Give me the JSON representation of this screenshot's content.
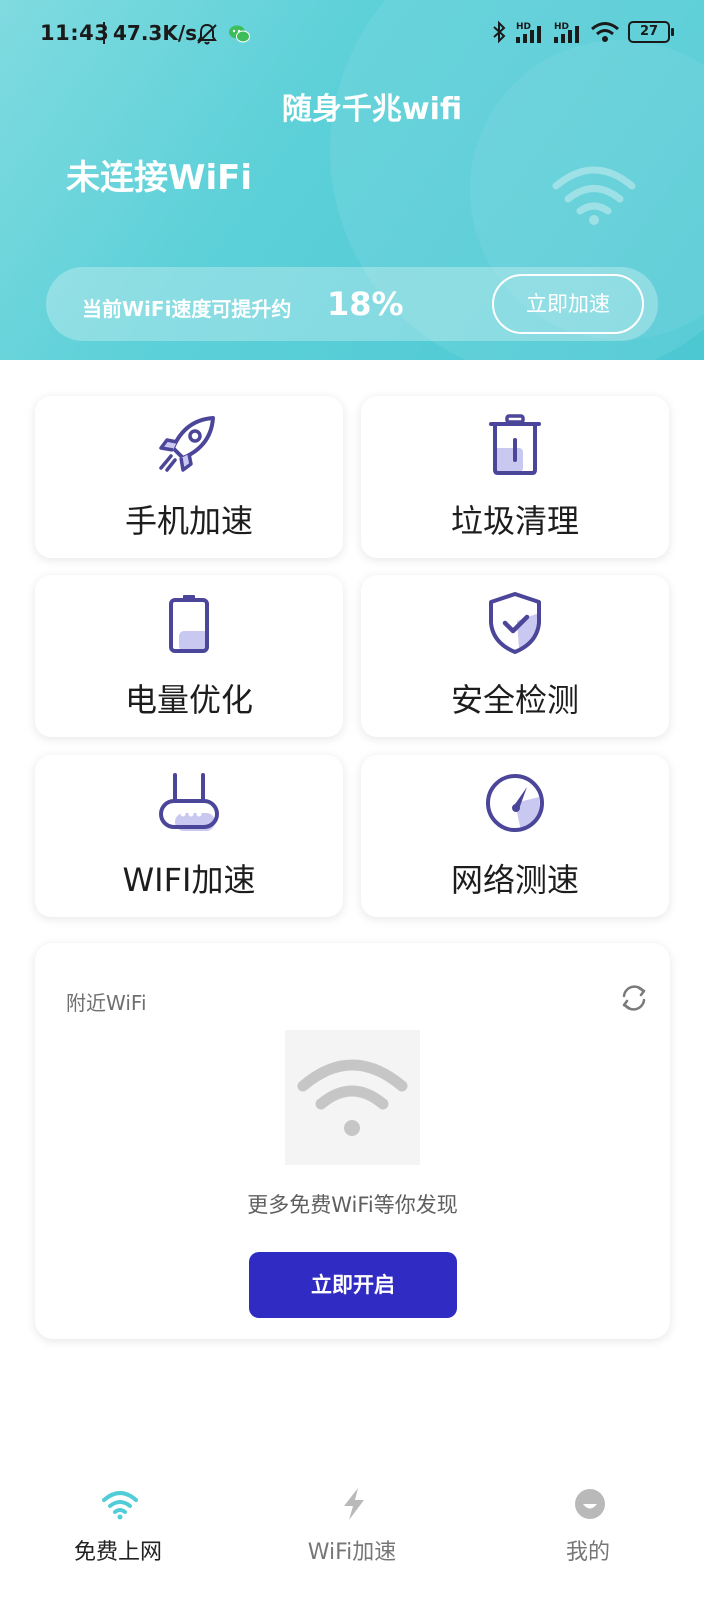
{
  "status_bar": {
    "time": "11:43",
    "speed": "47.3K/s",
    "battery": "27",
    "icons": [
      "bell-mute-icon",
      "wechat-icon",
      "bluetooth-icon",
      "signal-hd-icon",
      "signal-hd-icon",
      "wifi-icon",
      "battery-icon"
    ]
  },
  "header": {
    "app_title": "随身千兆wifi",
    "connection_status": "未连接WiFi",
    "boost_text": "当前WiFi速度可提升约",
    "boost_percent": "18%",
    "boost_button": "立即加速"
  },
  "features": [
    {
      "label": "手机加速",
      "icon": "rocket-icon"
    },
    {
      "label": "垃圾清理",
      "icon": "trash-icon"
    },
    {
      "label": "电量优化",
      "icon": "battery-icon"
    },
    {
      "label": "安全检测",
      "icon": "shield-check-icon"
    },
    {
      "label": "WIFI加速",
      "icon": "router-icon"
    },
    {
      "label": "网络测速",
      "icon": "speedometer-icon"
    }
  ],
  "nearby": {
    "title": "附近WiFi",
    "hint": "更多免费WiFi等你发现",
    "open_button": "立即开启"
  },
  "bottom_nav": [
    {
      "label": "免费上网",
      "icon": "wifi-icon",
      "active": true
    },
    {
      "label": "WiFi加速",
      "icon": "lightning-icon",
      "active": false
    },
    {
      "label": "我的",
      "icon": "profile-icon",
      "active": false
    }
  ],
  "colors": {
    "header": "#5dd0d8",
    "icon_purple": "#4b4699",
    "icon_fill": "#c9c8f0",
    "primary_button": "#2f2bc3",
    "nav_active": "#52cdd8",
    "nav_inactive": "#b9b9b9"
  }
}
